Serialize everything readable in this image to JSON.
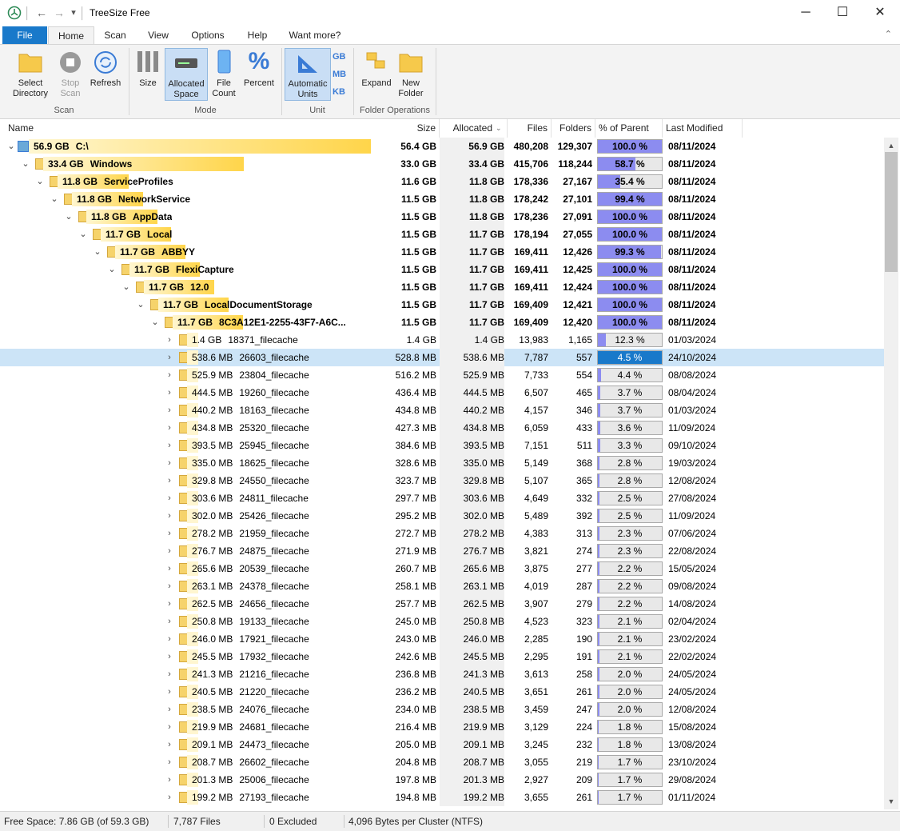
{
  "window": {
    "title": "TreeSize Free",
    "minimize_glyph": "─",
    "maximize_glyph": "☐",
    "close_glyph": "✕"
  },
  "quick_access": {
    "back_glyph": "←",
    "forward_glyph": "→",
    "menu_glyph": "▾"
  },
  "tabs": [
    "File",
    "Home",
    "Scan",
    "View",
    "Options",
    "Help",
    "Want more?"
  ],
  "active_tab": "Home",
  "collapse_glyph": "⌃",
  "ribbon": {
    "select_directory": "Select Directory",
    "stop_scan": "Stop Scan",
    "refresh": "Refresh",
    "size": "Size",
    "allocated_space": "Allocated Space",
    "file_count": "File Count",
    "percent": "Percent",
    "automatic_units": "Automatic Units",
    "unit_gb": "GB",
    "unit_mb": "MB",
    "unit_kb": "KB",
    "expand": "Expand",
    "new_folder": "New Folder",
    "group_scan": "Scan",
    "group_mode": "Mode",
    "group_unit": "Unit",
    "group_folder_ops": "Folder Operations"
  },
  "columns": {
    "name": "Name",
    "size": "Size",
    "allocated": "Allocated",
    "files": "Files",
    "folders": "Folders",
    "pct_parent": "% of Parent ...",
    "last_modified": "Last Modified"
  },
  "rows": [
    {
      "depth": 0,
      "chev": "⌄",
      "sizelabel": "56.9 GB",
      "name": "C:\\",
      "size": "56.4 GB",
      "allocated": "56.9 GB",
      "files": "480,208",
      "folders": "129,307",
      "pct": "100.0 %",
      "pct_value": 100,
      "modified": "08/11/2024",
      "bold": true,
      "bar_fraction": 1.0,
      "drive": true
    },
    {
      "depth": 1,
      "chev": "⌄",
      "sizelabel": "33.4 GB",
      "name": "Windows",
      "size": "33.0 GB",
      "allocated": "33.4 GB",
      "files": "415,706",
      "folders": "118,244",
      "pct": "58.7 %",
      "pct_value": 58.7,
      "modified": "08/11/2024",
      "bold": true,
      "bar_fraction": 0.587
    },
    {
      "depth": 2,
      "chev": "⌄",
      "sizelabel": "11.8 GB",
      "name": "ServiceProfiles",
      "size": "11.6 GB",
      "allocated": "11.8 GB",
      "files": "178,336",
      "folders": "27,167",
      "pct": "35.4 %",
      "pct_value": 35.4,
      "modified": "08/11/2024",
      "bold": true,
      "bar_fraction": 0.207
    },
    {
      "depth": 3,
      "chev": "⌄",
      "sizelabel": "11.8 GB",
      "name": "NetworkService",
      "size": "11.5 GB",
      "allocated": "11.8 GB",
      "files": "178,242",
      "folders": "27,101",
      "pct": "99.4 %",
      "pct_value": 99.4,
      "modified": "08/11/2024",
      "bold": true,
      "bar_fraction": 0.207
    },
    {
      "depth": 4,
      "chev": "⌄",
      "sizelabel": "11.8 GB",
      "name": "AppData",
      "size": "11.5 GB",
      "allocated": "11.8 GB",
      "files": "178,236",
      "folders": "27,091",
      "pct": "100.0 %",
      "pct_value": 100,
      "modified": "08/11/2024",
      "bold": true,
      "bar_fraction": 0.207
    },
    {
      "depth": 5,
      "chev": "⌄",
      "sizelabel": "11.7 GB",
      "name": "Local",
      "size": "11.5 GB",
      "allocated": "11.7 GB",
      "files": "178,194",
      "folders": "27,055",
      "pct": "100.0 %",
      "pct_value": 100,
      "modified": "08/11/2024",
      "bold": true,
      "bar_fraction": 0.206
    },
    {
      "depth": 6,
      "chev": "⌄",
      "sizelabel": "11.7 GB",
      "name": "ABBYY",
      "size": "11.5 GB",
      "allocated": "11.7 GB",
      "files": "169,411",
      "folders": "12,426",
      "pct": "99.3 %",
      "pct_value": 99.3,
      "modified": "08/11/2024",
      "bold": true,
      "bar_fraction": 0.206
    },
    {
      "depth": 7,
      "chev": "⌄",
      "sizelabel": "11.7 GB",
      "name": "FlexiCapture",
      "size": "11.5 GB",
      "allocated": "11.7 GB",
      "files": "169,411",
      "folders": "12,425",
      "pct": "100.0 %",
      "pct_value": 100,
      "modified": "08/11/2024",
      "bold": true,
      "bar_fraction": 0.206
    },
    {
      "depth": 8,
      "chev": "⌄",
      "sizelabel": "11.7 GB",
      "name": "12.0",
      "size": "11.5 GB",
      "allocated": "11.7 GB",
      "files": "169,411",
      "folders": "12,424",
      "pct": "100.0 %",
      "pct_value": 100,
      "modified": "08/11/2024",
      "bold": true,
      "bar_fraction": 0.206
    },
    {
      "depth": 9,
      "chev": "⌄",
      "sizelabel": "11.7 GB",
      "name": "LocalDocumentStorage",
      "size": "11.5 GB",
      "allocated": "11.7 GB",
      "files": "169,409",
      "folders": "12,421",
      "pct": "100.0 %",
      "pct_value": 100,
      "modified": "08/11/2024",
      "bold": true,
      "bar_fraction": 0.206
    },
    {
      "depth": 10,
      "chev": "⌄",
      "sizelabel": "11.7 GB",
      "name": "8C3A12E1-2255-43F7-A6C...",
      "size": "11.5 GB",
      "allocated": "11.7 GB",
      "files": "169,409",
      "folders": "12,420",
      "pct": "100.0 %",
      "pct_value": 100,
      "modified": "08/11/2024",
      "bold": true,
      "bar_fraction": 0.206
    },
    {
      "depth": 11,
      "chev": "›",
      "sizelabel": "1.4 GB",
      "name": "18371_filecache",
      "size": "1.4 GB",
      "allocated": "1.4 GB",
      "files": "13,983",
      "folders": "1,165",
      "pct": "12.3 %",
      "pct_value": 12.3,
      "modified": "01/03/2024",
      "bold": false
    },
    {
      "depth": 11,
      "chev": "›",
      "sizelabel": "538.6 MB",
      "name": "26603_filecache",
      "size": "528.8 MB",
      "allocated": "538.6 MB",
      "files": "7,787",
      "folders": "557",
      "pct": "4.5 %",
      "pct_value": 4.5,
      "modified": "24/10/2024",
      "bold": false,
      "selected": true
    },
    {
      "depth": 11,
      "chev": "›",
      "sizelabel": "525.9 MB",
      "name": "23804_filecache",
      "size": "516.2 MB",
      "allocated": "525.9 MB",
      "files": "7,733",
      "folders": "554",
      "pct": "4.4 %",
      "pct_value": 4.4,
      "modified": "08/08/2024",
      "bold": false
    },
    {
      "depth": 11,
      "chev": "›",
      "sizelabel": "444.5 MB",
      "name": "19260_filecache",
      "size": "436.4 MB",
      "allocated": "444.5 MB",
      "files": "6,507",
      "folders": "465",
      "pct": "3.7 %",
      "pct_value": 3.7,
      "modified": "08/04/2024",
      "bold": false
    },
    {
      "depth": 11,
      "chev": "›",
      "sizelabel": "440.2 MB",
      "name": "18163_filecache",
      "size": "434.8 MB",
      "allocated": "440.2 MB",
      "files": "4,157",
      "folders": "346",
      "pct": "3.7 %",
      "pct_value": 3.7,
      "modified": "01/03/2024",
      "bold": false
    },
    {
      "depth": 11,
      "chev": "›",
      "sizelabel": "434.8 MB",
      "name": "25320_filecache",
      "size": "427.3 MB",
      "allocated": "434.8 MB",
      "files": "6,059",
      "folders": "433",
      "pct": "3.6 %",
      "pct_value": 3.6,
      "modified": "11/09/2024",
      "bold": false
    },
    {
      "depth": 11,
      "chev": "›",
      "sizelabel": "393.5 MB",
      "name": "25945_filecache",
      "size": "384.6 MB",
      "allocated": "393.5 MB",
      "files": "7,151",
      "folders": "511",
      "pct": "3.3 %",
      "pct_value": 3.3,
      "modified": "09/10/2024",
      "bold": false
    },
    {
      "depth": 11,
      "chev": "›",
      "sizelabel": "335.0 MB",
      "name": "18625_filecache",
      "size": "328.6 MB",
      "allocated": "335.0 MB",
      "files": "5,149",
      "folders": "368",
      "pct": "2.8 %",
      "pct_value": 2.8,
      "modified": "19/03/2024",
      "bold": false
    },
    {
      "depth": 11,
      "chev": "›",
      "sizelabel": "329.8 MB",
      "name": "24550_filecache",
      "size": "323.7 MB",
      "allocated": "329.8 MB",
      "files": "5,107",
      "folders": "365",
      "pct": "2.8 %",
      "pct_value": 2.8,
      "modified": "12/08/2024",
      "bold": false
    },
    {
      "depth": 11,
      "chev": "›",
      "sizelabel": "303.6 MB",
      "name": "24811_filecache",
      "size": "297.7 MB",
      "allocated": "303.6 MB",
      "files": "4,649",
      "folders": "332",
      "pct": "2.5 %",
      "pct_value": 2.5,
      "modified": "27/08/2024",
      "bold": false
    },
    {
      "depth": 11,
      "chev": "›",
      "sizelabel": "302.0 MB",
      "name": "25426_filecache",
      "size": "295.2 MB",
      "allocated": "302.0 MB",
      "files": "5,489",
      "folders": "392",
      "pct": "2.5 %",
      "pct_value": 2.5,
      "modified": "11/09/2024",
      "bold": false
    },
    {
      "depth": 11,
      "chev": "›",
      "sizelabel": "278.2 MB",
      "name": "21959_filecache",
      "size": "272.7 MB",
      "allocated": "278.2 MB",
      "files": "4,383",
      "folders": "313",
      "pct": "2.3 %",
      "pct_value": 2.3,
      "modified": "07/06/2024",
      "bold": false
    },
    {
      "depth": 11,
      "chev": "›",
      "sizelabel": "276.7 MB",
      "name": "24875_filecache",
      "size": "271.9 MB",
      "allocated": "276.7 MB",
      "files": "3,821",
      "folders": "274",
      "pct": "2.3 %",
      "pct_value": 2.3,
      "modified": "22/08/2024",
      "bold": false
    },
    {
      "depth": 11,
      "chev": "›",
      "sizelabel": "265.6 MB",
      "name": "20539_filecache",
      "size": "260.7 MB",
      "allocated": "265.6 MB",
      "files": "3,875",
      "folders": "277",
      "pct": "2.2 %",
      "pct_value": 2.2,
      "modified": "15/05/2024",
      "bold": false
    },
    {
      "depth": 11,
      "chev": "›",
      "sizelabel": "263.1 MB",
      "name": "24378_filecache",
      "size": "258.1 MB",
      "allocated": "263.1 MB",
      "files": "4,019",
      "folders": "287",
      "pct": "2.2 %",
      "pct_value": 2.2,
      "modified": "09/08/2024",
      "bold": false
    },
    {
      "depth": 11,
      "chev": "›",
      "sizelabel": "262.5 MB",
      "name": "24656_filecache",
      "size": "257.7 MB",
      "allocated": "262.5 MB",
      "files": "3,907",
      "folders": "279",
      "pct": "2.2 %",
      "pct_value": 2.2,
      "modified": "14/08/2024",
      "bold": false
    },
    {
      "depth": 11,
      "chev": "›",
      "sizelabel": "250.8 MB",
      "name": "19133_filecache",
      "size": "245.0 MB",
      "allocated": "250.8 MB",
      "files": "4,523",
      "folders": "323",
      "pct": "2.1 %",
      "pct_value": 2.1,
      "modified": "02/04/2024",
      "bold": false
    },
    {
      "depth": 11,
      "chev": "›",
      "sizelabel": "246.0 MB",
      "name": "17921_filecache",
      "size": "243.0 MB",
      "allocated": "246.0 MB",
      "files": "2,285",
      "folders": "190",
      "pct": "2.1 %",
      "pct_value": 2.1,
      "modified": "23/02/2024",
      "bold": false
    },
    {
      "depth": 11,
      "chev": "›",
      "sizelabel": "245.5 MB",
      "name": "17932_filecache",
      "size": "242.6 MB",
      "allocated": "245.5 MB",
      "files": "2,295",
      "folders": "191",
      "pct": "2.1 %",
      "pct_value": 2.1,
      "modified": "22/02/2024",
      "bold": false
    },
    {
      "depth": 11,
      "chev": "›",
      "sizelabel": "241.3 MB",
      "name": "21216_filecache",
      "size": "236.8 MB",
      "allocated": "241.3 MB",
      "files": "3,613",
      "folders": "258",
      "pct": "2.0 %",
      "pct_value": 2.0,
      "modified": "24/05/2024",
      "bold": false
    },
    {
      "depth": 11,
      "chev": "›",
      "sizelabel": "240.5 MB",
      "name": "21220_filecache",
      "size": "236.2 MB",
      "allocated": "240.5 MB",
      "files": "3,651",
      "folders": "261",
      "pct": "2.0 %",
      "pct_value": 2.0,
      "modified": "24/05/2024",
      "bold": false
    },
    {
      "depth": 11,
      "chev": "›",
      "sizelabel": "238.5 MB",
      "name": "24076_filecache",
      "size": "234.0 MB",
      "allocated": "238.5 MB",
      "files": "3,459",
      "folders": "247",
      "pct": "2.0 %",
      "pct_value": 2.0,
      "modified": "12/08/2024",
      "bold": false
    },
    {
      "depth": 11,
      "chev": "›",
      "sizelabel": "219.9 MB",
      "name": "24681_filecache",
      "size": "216.4 MB",
      "allocated": "219.9 MB",
      "files": "3,129",
      "folders": "224",
      "pct": "1.8 %",
      "pct_value": 1.8,
      "modified": "15/08/2024",
      "bold": false
    },
    {
      "depth": 11,
      "chev": "›",
      "sizelabel": "209.1 MB",
      "name": "24473_filecache",
      "size": "205.0 MB",
      "allocated": "209.1 MB",
      "files": "3,245",
      "folders": "232",
      "pct": "1.8 %",
      "pct_value": 1.8,
      "modified": "13/08/2024",
      "bold": false
    },
    {
      "depth": 11,
      "chev": "›",
      "sizelabel": "208.7 MB",
      "name": "26602_filecache",
      "size": "204.8 MB",
      "allocated": "208.7 MB",
      "files": "3,055",
      "folders": "219",
      "pct": "1.7 %",
      "pct_value": 1.7,
      "modified": "23/10/2024",
      "bold": false
    },
    {
      "depth": 11,
      "chev": "›",
      "sizelabel": "201.3 MB",
      "name": "25006_filecache",
      "size": "197.8 MB",
      "allocated": "201.3 MB",
      "files": "2,927",
      "folders": "209",
      "pct": "1.7 %",
      "pct_value": 1.7,
      "modified": "29/08/2024",
      "bold": false
    },
    {
      "depth": 11,
      "chev": "›",
      "sizelabel": "199.2 MB",
      "name": "27193_filecache",
      "size": "194.8 MB",
      "allocated": "199.2 MB",
      "files": "3,655",
      "folders": "261",
      "pct": "1.7 %",
      "pct_value": 1.7,
      "modified": "01/11/2024",
      "bold": false
    }
  ],
  "status": {
    "free_space": "Free Space: 7.86 GB  (of 59.3 GB)",
    "files": "7,787 Files",
    "excluded": "0 Excluded",
    "cluster": "4,096 Bytes per Cluster (NTFS)"
  },
  "colors": {
    "size_bar": "#ffd54a",
    "pct_fill": "#8c8cf0",
    "pct_fill_selected": "#1979ca",
    "accent": "#1979ca"
  }
}
